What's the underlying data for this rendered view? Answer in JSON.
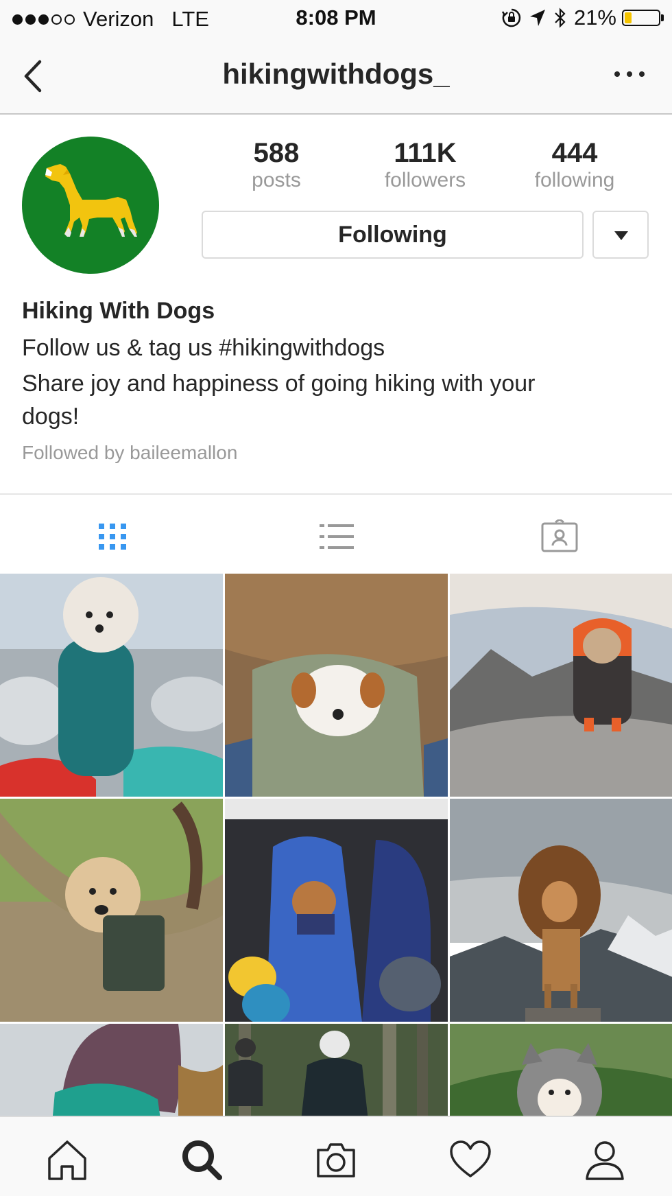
{
  "status_bar": {
    "carrier": "Verizon",
    "network": "LTE",
    "time": "8:08 PM",
    "battery_percent": "21%",
    "battery_level": 0.21,
    "signal_bars_filled": 3,
    "signal_bars_total": 5
  },
  "nav": {
    "username": "hikingwithdogs_",
    "back_icon": "chevron-left-icon",
    "more_icon": "more-horizontal-icon"
  },
  "profile": {
    "avatar_icon": "dog-logo-icon",
    "stats": [
      {
        "value": "588",
        "label": "posts"
      },
      {
        "value": "111K",
        "label": "followers"
      },
      {
        "value": "444",
        "label": "following"
      }
    ],
    "follow_button_label": "Following",
    "name": "Hiking With Dogs",
    "bio_line_1": "Follow us & tag us #hikingwithdogs",
    "bio_line_2": "Share joy and happiness of going hiking with your",
    "bio_line_3": "dogs!",
    "followed_by": "Followed by baileemallon"
  },
  "tabs": [
    {
      "icon": "grid-icon",
      "active": true
    },
    {
      "icon": "list-icon",
      "active": false
    },
    {
      "icon": "tagged-icon",
      "active": false
    }
  ],
  "colors": {
    "accent": "#3897f0",
    "avatar_bg": "#138126",
    "avatar_dog": "#f2c40f",
    "text": "#262626",
    "muted": "#999999"
  },
  "bottom_nav": [
    {
      "icon": "home-icon"
    },
    {
      "icon": "search-icon"
    },
    {
      "icon": "camera-icon"
    },
    {
      "icon": "heart-icon"
    },
    {
      "icon": "profile-icon"
    }
  ]
}
